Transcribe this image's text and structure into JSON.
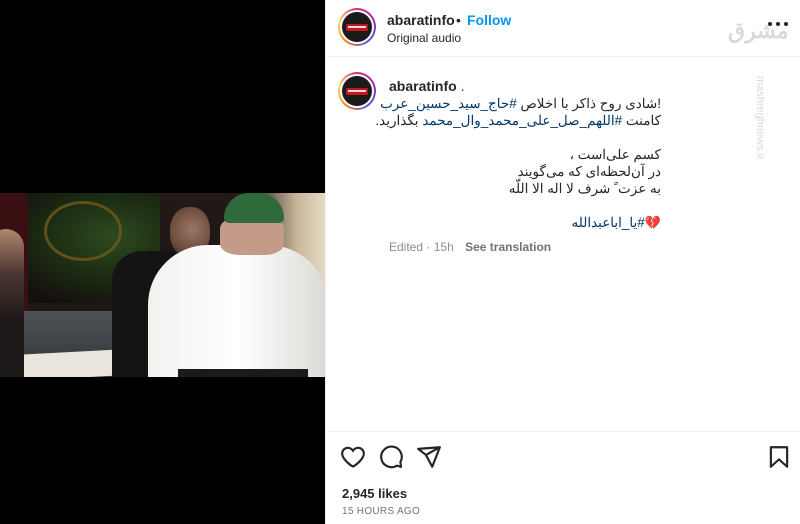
{
  "post": {
    "author": "abaratinfo",
    "follow_label": "Follow",
    "separator": "•",
    "audio": "Original audio"
  },
  "watermark": {
    "arabic": "مشرق",
    "latin": "mashreghnews.ir"
  },
  "caption": {
    "author": "abaratinfo",
    "author_suffix": " .",
    "line1_text": "شادی روح ذاکر با اخلاص ",
    "line1_hash": "#حاج_سید_حسین_عرب",
    "line1_end": "!",
    "line2_text": "کامنت ",
    "line2_hash": "#اللهم_صل_علی_محمد_وال_محمد",
    "line2_end": " بگذارید.",
    "line3": "کسم علی‌است ،",
    "line4": "در آن‌لحظه‌ای که می‌گویند",
    "line5": "به عزت ً شرف لا اله الا اللّه",
    "line6_emoji": "💔",
    "line6_hash": "#یا_اباعبدالله",
    "edited": "Edited",
    "age": "15h",
    "see_translation": "See translation"
  },
  "stats": {
    "likes": "2,945 likes",
    "posted": "15 HOURS AGO"
  },
  "icons": {
    "like": "heart-icon",
    "comment": "comment-icon",
    "share": "send-icon",
    "save": "bookmark-icon",
    "more": "more-horizontal-icon"
  },
  "colors": {
    "link": "#0095f6",
    "hashtag": "#00376b",
    "muted": "#8e8e8e",
    "text": "#262626"
  }
}
